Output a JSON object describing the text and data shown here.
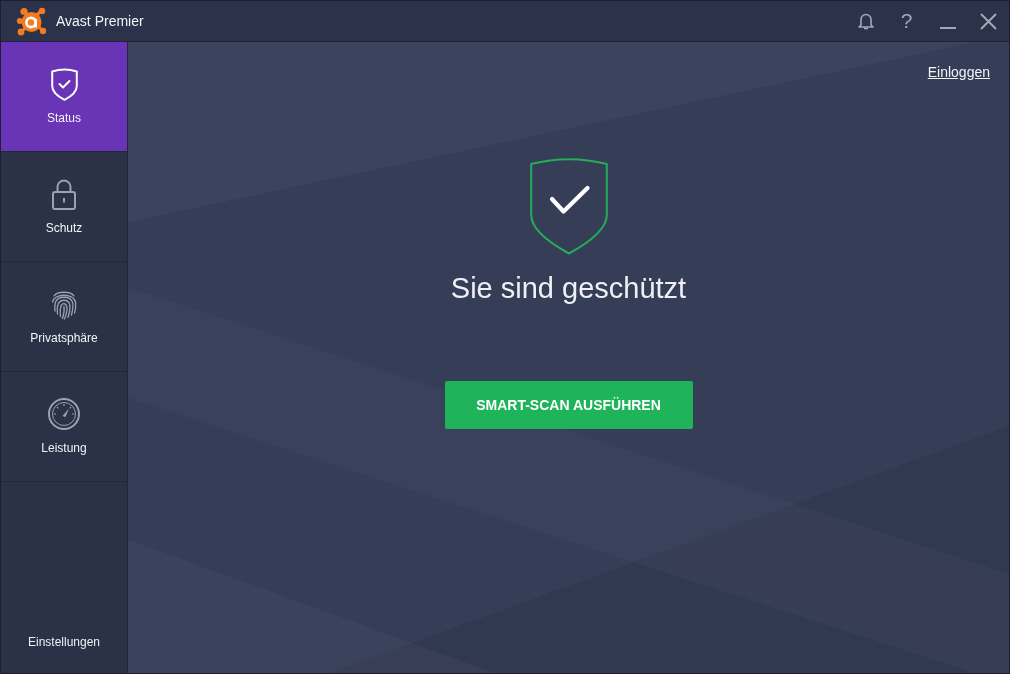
{
  "window": {
    "title": "Avast Premier"
  },
  "title_bar": {
    "help_label": "?"
  },
  "sidebar": {
    "items": [
      {
        "kind": "shield",
        "label": "Status",
        "selected": true
      },
      {
        "kind": "lock",
        "label": "Schutz",
        "selected": false
      },
      {
        "kind": "fingerprint",
        "label": "Privatsphäre",
        "selected": false
      },
      {
        "kind": "gauge",
        "label": "Leistung",
        "selected": false
      }
    ],
    "footer_item": "Einstellungen"
  },
  "main": {
    "login_link": "Einloggen",
    "status": {
      "kind": "protected",
      "heading": "Sie sind geschützt"
    },
    "action_button": "SMART-SCAN AUSFÜHREN"
  }
}
